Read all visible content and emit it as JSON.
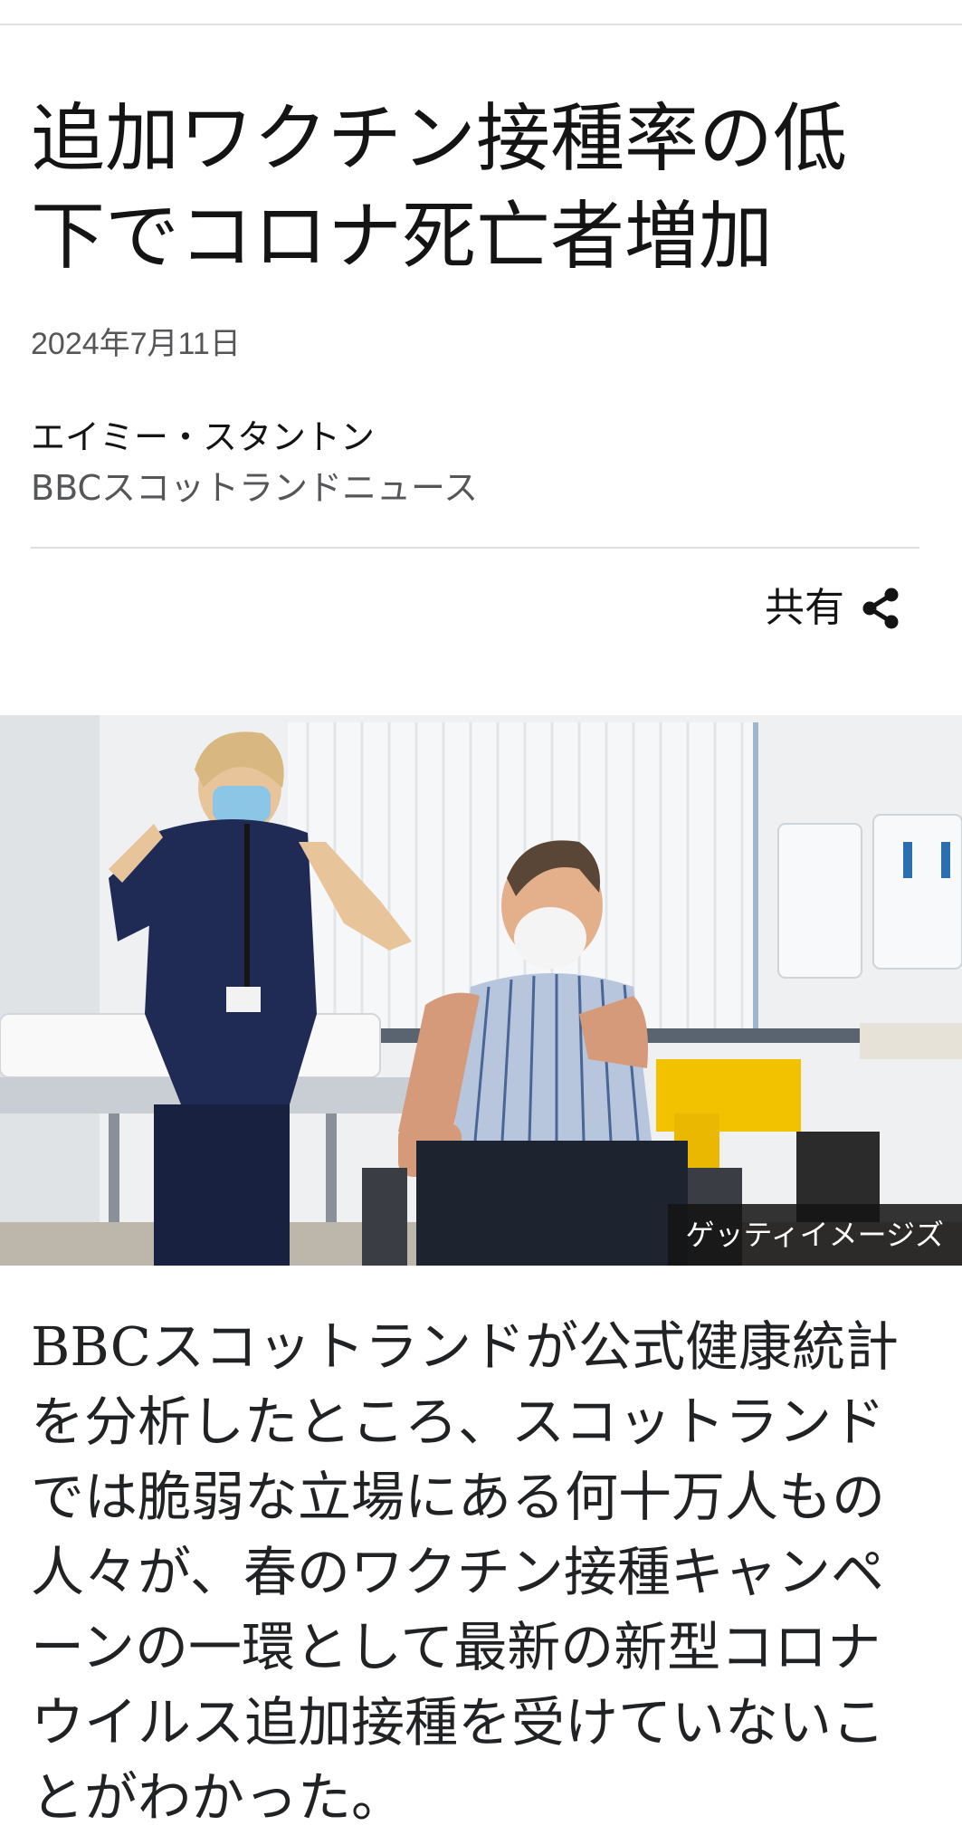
{
  "article": {
    "headline": "追加ワクチン接種率の低下でコロナ死亡者増加",
    "date": "2024年7月11日",
    "author": "エイミー・スタントン",
    "affiliation": "BBCスコットランドニュース",
    "share_label": "共有",
    "image_credit": "ゲッティイメージズ",
    "body": "BBCスコットランドが公式健康統計を分析したところ、スコットランドでは脆弱な立場にある何十万人もの人々が、春のワクチン接種キャンペーンの一環として最新の新型コロナウイルス追加接種を受けていないことがわかった。"
  },
  "icons": {
    "share": "share-icon"
  },
  "colors": {
    "text": "#141414",
    "meta": "#545658",
    "rule": "#dedede",
    "credit_bg": "#141414"
  }
}
